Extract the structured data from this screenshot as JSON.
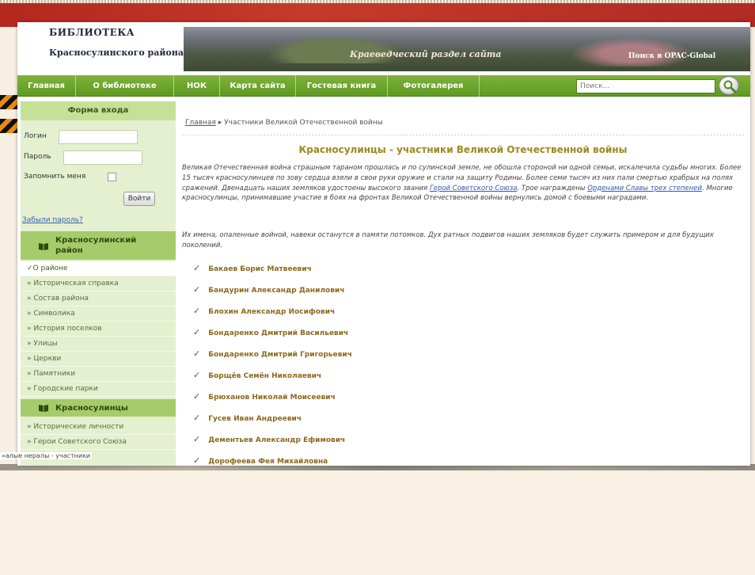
{
  "header": {
    "logo_line1": "БИБЛИОТЕКА",
    "logo_line2": "Красносулинского района",
    "banner_caption": "Краеведческий раздел сайта",
    "opac_link": "Поиск в OPAC-Global"
  },
  "nav": {
    "items": [
      "Главная",
      "О библиотеке",
      "НОК",
      "Карта сайта",
      "Гостевая книга",
      "Фотогалерея"
    ],
    "search_placeholder": "Поиск..."
  },
  "login": {
    "title": "Форма входа",
    "login_label": "Логин",
    "password_label": "Пароль",
    "remember_label": "Запомнить меня",
    "button": "Войти",
    "forgot": "Забыли пароль?"
  },
  "sidebar": {
    "section1_title": "Красносулинский район",
    "section1_items": [
      "✓О районе",
      "» Историческая справка",
      "» Состав района",
      "» Символика",
      "» История поселков",
      "» Улицы",
      "» Церкви",
      "» Памятники",
      "» Городские парки"
    ],
    "section2_title": "Красносулинцы",
    "section2_items": [
      "» Исторические личности",
      "» Герои Советского Союза"
    ],
    "overflow_text": "»алые нералы - участники"
  },
  "content": {
    "breadcrumb_home": "Главная",
    "breadcrumb_sep": "▸",
    "breadcrumb_current": "Участники Великой Отечественной войны",
    "title": "Красносулинцы - участники Великой Отечественной войны",
    "para1_part1": "Великая Отечественная война страшным тараном прошлась и по сулинской земле, не обошла стороной ни одной семьи, искалечила судьбы многих.  Более 15 тысяч красносулинцев по зову сердца взяли в свои руки оружие и стали на защиту Родины.   Более семи тысяч из них пали смертью храбрых на полях сражений. Двенадцать наших земляков удостоены высокого звания ",
    "para1_link1": "Герой Советского Союза",
    "para1_part2": ". Трое награждены ",
    "para1_link2": "Орденами Славы трех степеней",
    "para1_part3": ". Многие красносулинцы, принимавшие участие в боях на фронтах Великой Отечественной войны вернулись домой с боевыми наградами.",
    "para2": "Их имена, опаленные войной, навеки останутся в памяти потомков. Дух ратных подвигов наших земляков будет служить примером и для будущих поколений.",
    "check_mark": "✓",
    "people": [
      "Бакаев Борис Матвеевич",
      "Бандурин Александр Данилович",
      "Блохин Александр Иосифович",
      "Бондаренко Дмитрий Васильевич",
      "Бондаренко Дмитрий Григорьевич",
      "Борщёв Семён Николаевич",
      "Брюханов Николай Моисеевич",
      "Гусев Иван Андреевич",
      "Дементьев Александр Ефимович",
      "Дорофеева Фея Михайловна"
    ]
  },
  "colors": {
    "nav_green": "#6aa82a",
    "sidebar_bg": "#e4f0cf",
    "title_gold": "#9c8a1e",
    "name_brown": "#8b6a1c",
    "link_blue": "#2f58b5"
  }
}
